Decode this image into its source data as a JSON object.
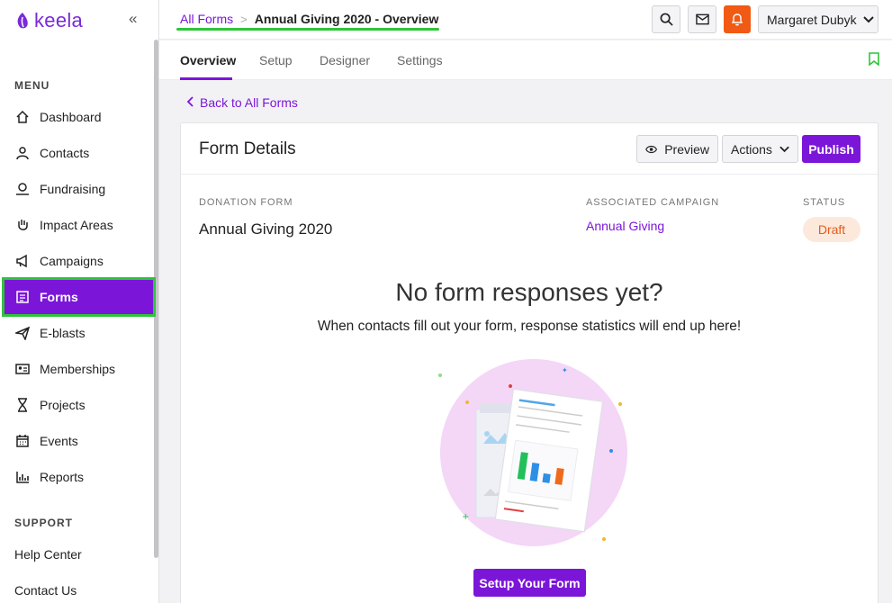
{
  "sidebar": {
    "logo_text": "keela",
    "menu_label": "MENU",
    "support_label": "SUPPORT",
    "items": [
      {
        "label": "Dashboard",
        "icon": "home-icon"
      },
      {
        "label": "Contacts",
        "icon": "person-icon"
      },
      {
        "label": "Fundraising",
        "icon": "donation-icon"
      },
      {
        "label": "Impact Areas",
        "icon": "hand-icon"
      },
      {
        "label": "Campaigns",
        "icon": "megaphone-icon"
      },
      {
        "label": "Forms",
        "icon": "form-list-icon"
      },
      {
        "label": "E-blasts",
        "icon": "paper-plane-icon"
      },
      {
        "label": "Memberships",
        "icon": "id-card-icon"
      },
      {
        "label": "Projects",
        "icon": "hourglass-icon"
      },
      {
        "label": "Events",
        "icon": "calendar-icon"
      },
      {
        "label": "Reports",
        "icon": "bar-chart-icon"
      }
    ],
    "support_items": [
      {
        "label": "Help Center"
      },
      {
        "label": "Contact Us"
      }
    ],
    "active_item": "Forms"
  },
  "topbar": {
    "breadcrumb_link": "All Forms",
    "breadcrumb_current": "Annual Giving 2020 - Overview",
    "user_name": "Margaret Dubyk"
  },
  "tabs": [
    "Overview",
    "Setup",
    "Designer",
    "Settings"
  ],
  "active_tab": "Overview",
  "main": {
    "back_link": "Back to All Forms",
    "card_title": "Form Details",
    "preview_label": "Preview",
    "actions_label": "Actions",
    "publish_label": "Publish",
    "donation_form_label": "DONATION FORM",
    "donation_form_value": "Annual Giving 2020",
    "campaign_label": "ASSOCIATED CAMPAIGN",
    "campaign_value": "Annual Giving",
    "status_label": "STATUS",
    "status_value": "Draft",
    "empty_title": "No form responses yet?",
    "empty_subtitle": "When contacts fill out your form, response statistics will end up here!",
    "setup_button": "Setup Your Form"
  },
  "colors": {
    "brand_purple": "#7b16d9",
    "highlight_green": "#2ec43a",
    "bell_orange": "#f05a14",
    "draft_badge_bg": "#fde9dc",
    "draft_badge_text": "#e55b18"
  }
}
